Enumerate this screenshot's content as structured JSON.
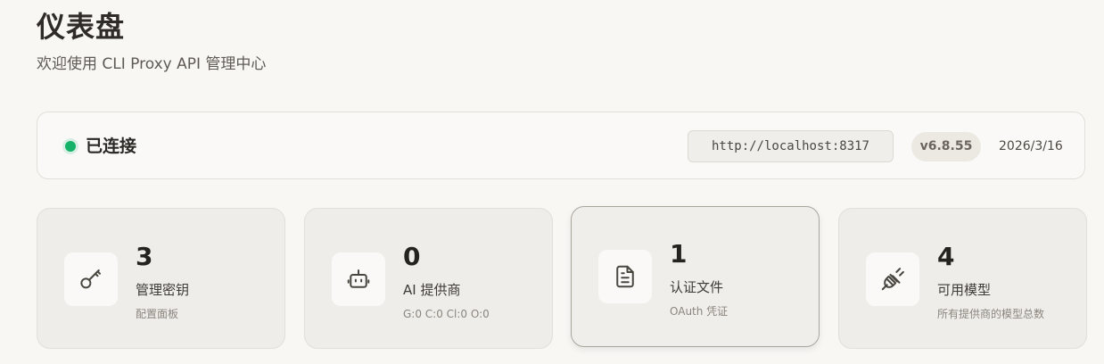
{
  "header": {
    "title": "仪表盘",
    "subtitle": "欢迎使用 CLI Proxy API 管理中心"
  },
  "connection": {
    "status": "已连接",
    "api_url": "http://localhost:8317",
    "version": "v6.8.55",
    "date": "2026/3/16",
    "status_color": "#17b26a"
  },
  "stats": [
    {
      "value": "3",
      "label": "管理密钥",
      "detail": "配置面板",
      "icon": "key-icon"
    },
    {
      "value": "0",
      "label": "AI 提供商",
      "detail": "G:0 C:0 Cl:0 O:0",
      "icon": "robot-icon"
    },
    {
      "value": "1",
      "label": "认证文件",
      "detail": "OAuth 凭证",
      "icon": "file-icon"
    },
    {
      "value": "4",
      "label": "可用模型",
      "detail": "所有提供商的模型总数",
      "icon": "plug-icon"
    }
  ]
}
